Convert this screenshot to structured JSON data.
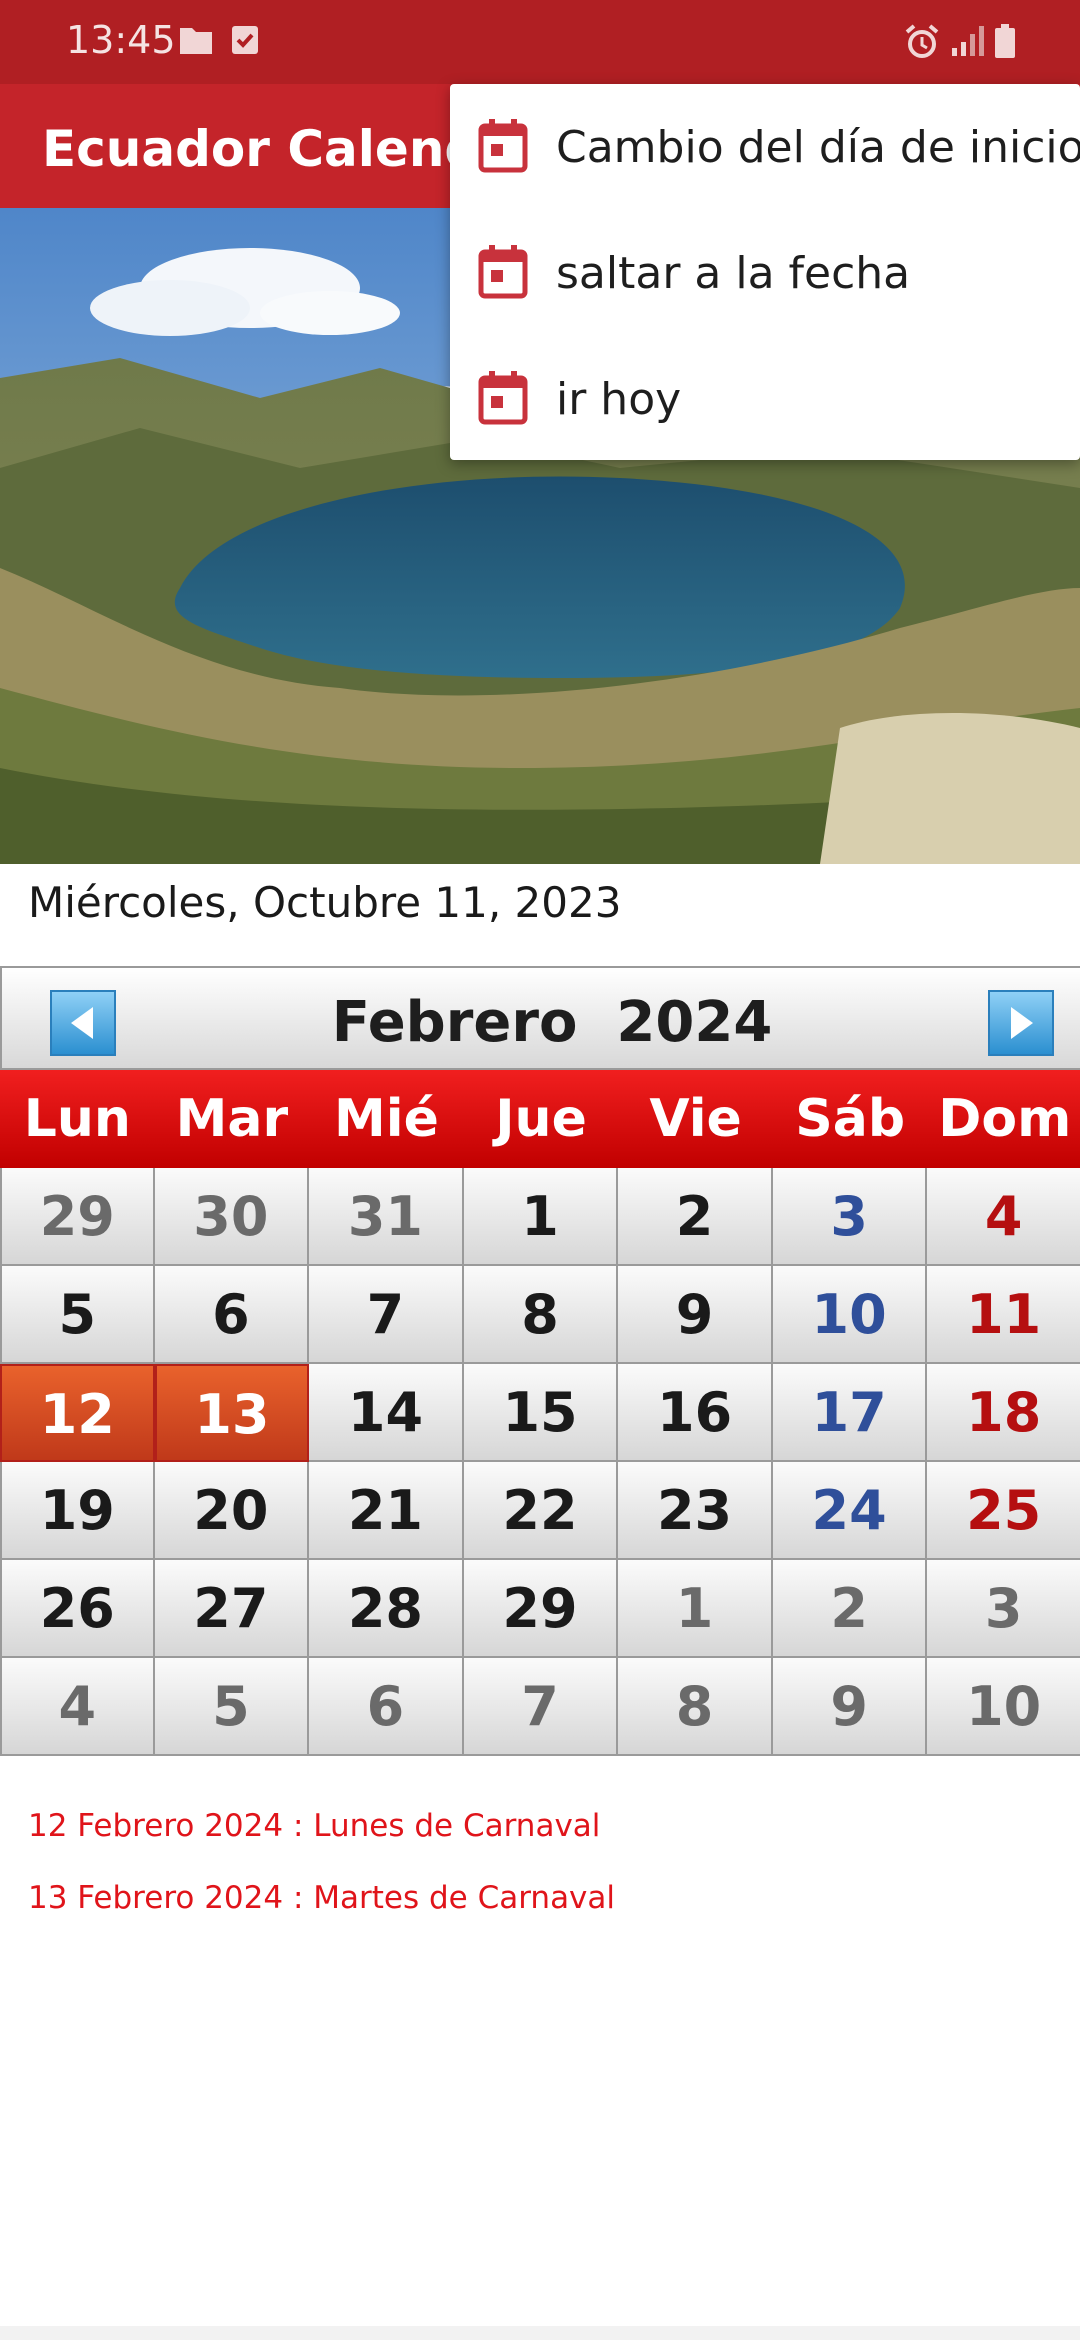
{
  "status_bar": {
    "time": "13:45",
    "left_icons": [
      "folder-icon",
      "checkbox-icon"
    ],
    "right_icons": [
      "alarm-icon",
      "signal-icon",
      "battery-icon"
    ]
  },
  "app_bar": {
    "title": "Ecuador Calendario"
  },
  "menu": {
    "items": [
      {
        "label": "Cambio del día de inicio",
        "icon": "calendar-icon"
      },
      {
        "label": "saltar a la fecha",
        "icon": "calendar-icon"
      },
      {
        "label": "ir hoy",
        "icon": "calendar-icon"
      }
    ]
  },
  "current_date": "Miércoles, Octubre 11, 2023",
  "calendar": {
    "month_title": "Febrero  2024",
    "prev_icon": "left-arrow-icon",
    "next_icon": "right-arrow-icon",
    "weekdays": [
      "Lun",
      "Mar",
      "Mié",
      "Jue",
      "Vie",
      "Sáb",
      "Dom"
    ],
    "weeks": [
      [
        "29",
        "30",
        "31",
        "1",
        "2",
        "3",
        "4"
      ],
      [
        "5",
        "6",
        "7",
        "8",
        "9",
        "10",
        "11"
      ],
      [
        "12",
        "13",
        "14",
        "15",
        "16",
        "17",
        "18"
      ],
      [
        "19",
        "20",
        "21",
        "22",
        "23",
        "24",
        "25"
      ],
      [
        "26",
        "27",
        "28",
        "29",
        "1",
        "2",
        "3"
      ],
      [
        "4",
        "5",
        "6",
        "7",
        "8",
        "9",
        "10"
      ]
    ],
    "colors": {
      "saturday": "#2f4f9a",
      "sunday": "#b50f10",
      "other_month": "#6a6a6a",
      "holiday_bg": "#d94a22"
    }
  },
  "holidays": [
    "12 Febrero 2024 : Lunes de Carnaval",
    "13 Febrero 2024 : Martes de Carnaval"
  ],
  "theme": {
    "status_bar": "#b01f23",
    "app_bar": "#c4242a",
    "holiday_text": "#e0141a"
  }
}
